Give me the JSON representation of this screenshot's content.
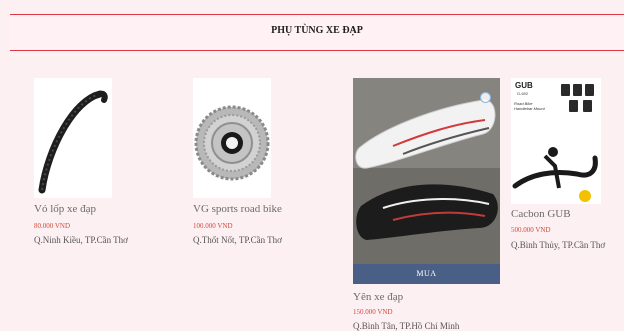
{
  "section": {
    "title": "PHỤ TÙNG XE ĐẠP"
  },
  "products": [
    {
      "name": "Vỏ lốp xe đạp",
      "price": "80.000 VND",
      "location": "Q.Ninh Kiều, TP.Cần Thơ",
      "image_icon": "bicycle-tire"
    },
    {
      "name": "VG sports road bike",
      "price": "100.000 VND",
      "location": "Q.Thốt Nốt, TP.Cần Thơ",
      "image_icon": "cassette-sprocket"
    },
    {
      "name": "Yên xe đạp",
      "price": "150.000 VND",
      "location": "Q.Bình Tân, TP.Hồ Chí Minh",
      "image_icon": "bike-saddle",
      "buy_label": "MUA",
      "zoom_icon": "zoom-icon"
    },
    {
      "name": "Cacbon GUB",
      "price": "500.000 VND",
      "location": "Q.Bình Thủy, TP.Cần Thơ",
      "image_icon": "carbon-handlebar",
      "brand": "GUB",
      "model": "G-692",
      "caption": "Road Bike Handlebar Mount"
    }
  ],
  "colors": {
    "accent": "#d93a45",
    "price": "#d24a3a",
    "button": "#4a5f86",
    "background": "#fdf0f3"
  }
}
